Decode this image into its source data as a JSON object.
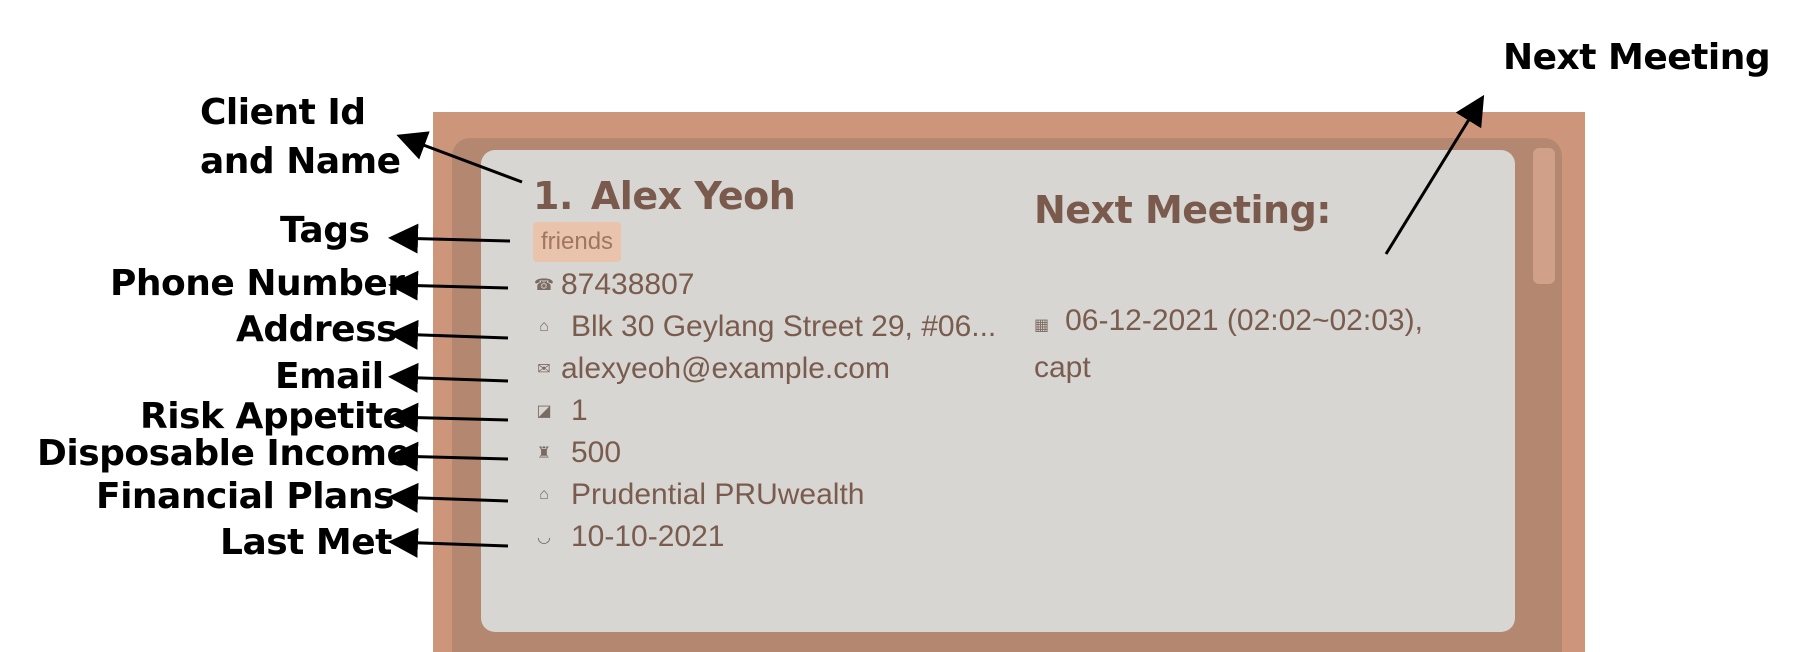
{
  "annotations": {
    "client_id_name": [
      "Client Id",
      "and Name"
    ],
    "tags": "Tags",
    "phone": "Phone Number",
    "address": "Address",
    "email": "Email",
    "risk": "Risk Appetite",
    "income": "Disposable Income",
    "plans": "Financial Plans",
    "last_met": "Last Met",
    "next_meeting": "Next Meeting"
  },
  "client": {
    "index": "1.",
    "name": "Alex Yeoh",
    "tags": [
      "friends"
    ],
    "phone": "87438807",
    "address": "Blk 30 Geylang Street 29, #06...",
    "email": "alexyeoh@example.com",
    "risk_appetite": "1",
    "disposable_income": "500",
    "financial_plans": "Prudential PRUwealth",
    "last_met": "10-10-2021",
    "next_meeting_header": "Next Meeting:",
    "next_meeting": "06-12-2021 (02:02~02:03), capt"
  },
  "icons": {
    "phone": "phone-icon",
    "address": "house-icon",
    "email": "envelope-icon",
    "risk": "chart-icon",
    "income": "money-bag-icon",
    "plans": "bank-icon",
    "last_met": "handshake-icon",
    "next_meeting": "calendar-icon"
  },
  "colors": {
    "outer_frame": "#cd967b",
    "inner_frame": "#b48870",
    "card_bg": "#d8d6d2",
    "text": "#7a5c4e",
    "tag_bg": "#e9c3ab"
  }
}
